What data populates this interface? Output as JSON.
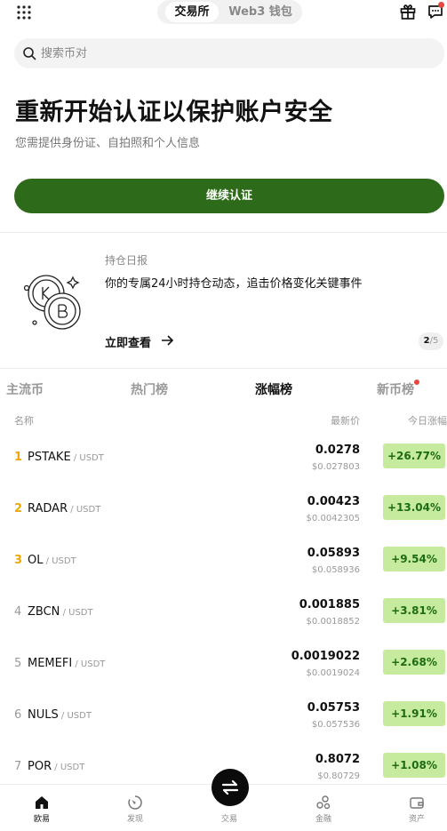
{
  "header": {
    "segments": [
      "交易所",
      "Web3 钱包"
    ],
    "active_segment": 0
  },
  "search": {
    "placeholder": "搜索币对"
  },
  "verify": {
    "title": "重新开始认证以保护账户安全",
    "subtitle": "您需提供身份证、自拍照和个人信息",
    "button": "继续认证"
  },
  "promo": {
    "tag": "持仓日报",
    "text": "你的专属24小时持仓动态，追击价格变化关键事件",
    "link": "立即查看",
    "page_current": "2",
    "page_total": "/5"
  },
  "tabs": [
    "主流币",
    "热门榜",
    "涨幅榜",
    "新币榜"
  ],
  "active_tab": 2,
  "columns": {
    "name": "名称",
    "price": "最新价",
    "change": "今日涨幅"
  },
  "rows": [
    {
      "rank": "1",
      "symbol": "PSTAKE",
      "quote": " / USDT",
      "price": "0.0278",
      "usd": "$0.027803",
      "change": "+26.77%"
    },
    {
      "rank": "2",
      "symbol": "RADAR",
      "quote": " / USDT",
      "price": "0.00423",
      "usd": "$0.0042305",
      "change": "+13.04%"
    },
    {
      "rank": "3",
      "symbol": "OL",
      "quote": " / USDT",
      "price": "0.05893",
      "usd": "$0.058936",
      "change": "+9.54%"
    },
    {
      "rank": "4",
      "symbol": "ZBCN",
      "quote": " / USDT",
      "price": "0.001885",
      "usd": "$0.0018852",
      "change": "+3.81%"
    },
    {
      "rank": "5",
      "symbol": "MEMEFI",
      "quote": " / USDT",
      "price": "0.0019022",
      "usd": "$0.0019024",
      "change": "+2.68%"
    },
    {
      "rank": "6",
      "symbol": "NULS",
      "quote": " / USDT",
      "price": "0.05753",
      "usd": "$0.057536",
      "change": "+1.91%"
    },
    {
      "rank": "7",
      "symbol": "POR",
      "quote": " / USDT",
      "price": "0.8072",
      "usd": "$0.80729",
      "change": "+1.08%"
    }
  ],
  "nav": [
    {
      "label": "欧易",
      "icon": "home-icon"
    },
    {
      "label": "发现",
      "icon": "discover-icon"
    },
    {
      "label": "交易",
      "icon": "trade-icon"
    },
    {
      "label": "金融",
      "icon": "finance-icon"
    },
    {
      "label": "资产",
      "icon": "wallet-icon"
    }
  ],
  "colors": {
    "primary_button": "#2d6a1a",
    "gain_bg": "#c6eb9e",
    "gain_text": "#1d6b14",
    "rank_top": "#f0a800",
    "notify_dot": "#e6473c"
  }
}
